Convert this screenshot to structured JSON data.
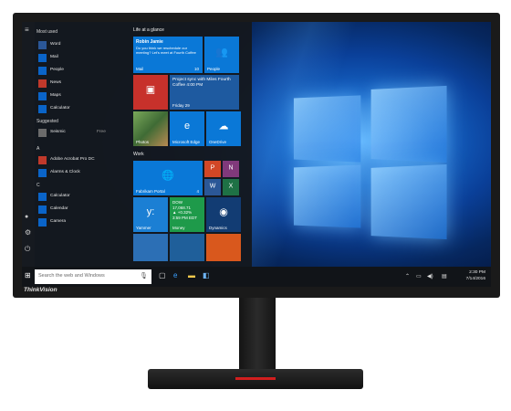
{
  "brand": "ThinkVision",
  "start_menu": {
    "hamburger_icon": "hamburger-icon",
    "most_used_header": "Most used",
    "most_used": [
      {
        "label": "Word",
        "color": "#2b5797"
      },
      {
        "label": "Mail",
        "color": "#0a64c8"
      },
      {
        "label": "People",
        "color": "#0a64c8"
      },
      {
        "label": "News",
        "color": "#c0392b"
      },
      {
        "label": "Maps",
        "color": "#0a64c8"
      },
      {
        "label": "Calculator",
        "color": "#0a64c8"
      }
    ],
    "suggested_header": "Suggested",
    "suggested": [
      {
        "label": "Seismic",
        "badge": "Free"
      }
    ],
    "letters": [
      {
        "letter": "A",
        "apps": [
          {
            "label": "Adobe Acrobat Pro DC",
            "color": "#c0392b"
          },
          {
            "label": "Alarms & Clock",
            "color": "#0a64c8"
          }
        ]
      },
      {
        "letter": "C",
        "apps": [
          {
            "label": "Calculator",
            "color": "#0a64c8"
          },
          {
            "label": "Calendar",
            "color": "#0a64c8"
          },
          {
            "label": "Camera",
            "color": "#0a64c8"
          }
        ]
      }
    ]
  },
  "tiles": {
    "group1": "Life at a glance",
    "group2": "Work",
    "mail": {
      "from": "Robin Jamie",
      "body": "Do you think we reschedule our meeting? Let's meet at Fourth Coffee",
      "label": "Mail",
      "count": "10"
    },
    "people": "People",
    "project": {
      "text": "Project sync with Miles Fourth Coffee 4:00 PM",
      "label": "Friday 29"
    },
    "photos": "Photos",
    "edge": "Microsoft Edge",
    "onedrive": "OneDrive",
    "portal": {
      "label": "Fabrikam Portal",
      "count": "4"
    },
    "yammer": "Yammer",
    "money": {
      "ticker": "DOW",
      "value": "17,068.71",
      "change": "▲ +0.32%",
      "time": "3:59 PM EDT",
      "label": "Money"
    },
    "dynamics": "Dynamics"
  },
  "taskbar": {
    "search_placeholder": "Search the web and Windows",
    "time": "2:30 PM",
    "date": "7/14/2016"
  }
}
